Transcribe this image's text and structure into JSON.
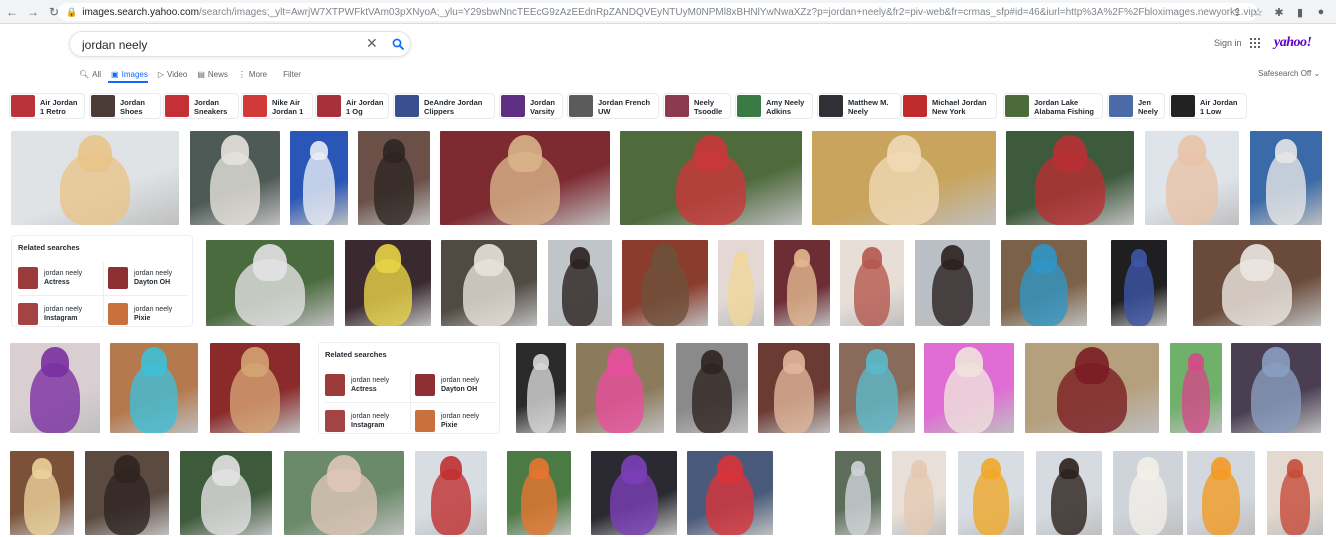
{
  "browser": {
    "url_host": "images.search.yahoo.com",
    "url_rest": "/search/images;_ylt=AwrjW7XTPWFktVAm03pXNyoA;_ylu=Y29sbwNncTEEcG9zAzEEdnRpZANDQVEyNTUyM0NPMl8xBHNlYwNwaXZz?p=jordan+neely&fr2=piv-web&fr=crmas_sfp#id=46&iurl=http%3A%2F%2Fbloximages.newyork1.vip.townnews.com%2Fstltoday.com%2Fcontent%2Ftncms%2Fassets%2..."
  },
  "search": {
    "query": "jordan neely",
    "clear_icon": "close-icon",
    "search_icon": "search-icon"
  },
  "header": {
    "sign_in": "Sign in",
    "logo": "yahoo!"
  },
  "tabs": [
    {
      "label": "All",
      "icon": "search-icon"
    },
    {
      "label": "Images",
      "icon": "image-icon",
      "active": true
    },
    {
      "label": "Video",
      "icon": "play-icon"
    },
    {
      "label": "News",
      "icon": "news-icon"
    },
    {
      "label": "More",
      "icon": "more-icon"
    },
    {
      "label": "Filter",
      "icon": ""
    }
  ],
  "safesearch": "Safesearch Off ⌄",
  "pills": [
    {
      "label": "Air Jordan\n1 Retro",
      "color": "#b8343a"
    },
    {
      "label": "Jordan\nShoes",
      "color": "#4a3b36"
    },
    {
      "label": "Jordan\nSneakers",
      "color": "#c43035"
    },
    {
      "label": "Nike Air\nJordan 1",
      "color": "#d23a3a"
    },
    {
      "label": "Air Jordan\n1 Og",
      "color": "#a7303a"
    },
    {
      "label": "DeAndre Jordan\nClippers",
      "color": "#3a4f8f"
    },
    {
      "label": "Jordan\nVarsity",
      "color": "#5e2f82"
    },
    {
      "label": "Jordan French\nUW",
      "color": "#5b5b5b"
    },
    {
      "label": "Neely\nTsoodle",
      "color": "#8c3a4f"
    },
    {
      "label": "Amy Neely\nAdkins",
      "color": "#3a7a44"
    },
    {
      "label": "Matthew M.\nNeely",
      "color": "#2f2f35"
    },
    {
      "label": "Michael Jordan\nNew York",
      "color": "#c02b2b"
    },
    {
      "label": "Jordan Lake\nAlabama Fishing",
      "color": "#4c6a3a"
    },
    {
      "label": "Jen\nNeely",
      "color": "#4a6aa8"
    },
    {
      "label": "Air Jordan\n1 Low",
      "color": "#222222"
    }
  ],
  "related_label": "Related searches",
  "related": [
    {
      "l1": "jordan neely",
      "l2": "Actress",
      "color": "#9c3b3b"
    },
    {
      "l1": "jordan neely",
      "l2": "Dayton OH",
      "color": "#8e2f34"
    },
    {
      "l1": "jordan neely",
      "l2": "Instagram",
      "color": "#a34343"
    },
    {
      "l1": "jordan neely",
      "l2": "Pixie",
      "color": "#c9703f"
    }
  ],
  "image_rows": [
    [
      {
        "bg": "#dfe3e6",
        "fig": "#e8c48a"
      },
      {
        "bg": "#4e5a55",
        "fig": "#e6e2dc"
      },
      {
        "bg": "#2a56b8",
        "fig": "#e9eef5"
      },
      {
        "bg": "#6b5048",
        "fig": "#2d2522"
      },
      {
        "bg": "#7d2a31",
        "fig": "#d9b48b"
      },
      {
        "bg": "#4f6b3d",
        "fig": "#c9373a"
      },
      {
        "bg": "#c9a45c",
        "fig": "#f0d9b5"
      },
      {
        "bg": "#3e5a3d",
        "fig": "#b83033"
      },
      {
        "bg": "#dfe4ea",
        "fig": "#e9c3a8"
      },
      {
        "bg": "#3b6aa8",
        "fig": "#e7e7e7"
      }
    ],
    [
      {
        "bg": "#4a6b3e",
        "fig": "#e2e2e2"
      },
      {
        "bg": "#3a2a2f",
        "fig": "#e8d447"
      },
      {
        "bg": "#4f4a42",
        "fig": "#e7e2da"
      },
      {
        "bg": "#bfc5c9",
        "fig": "#2a211f"
      },
      {
        "bg": "#8a3c2d",
        "fig": "#6e5039"
      },
      {
        "bg": "#e4d8d4",
        "fig": "#f0d79a"
      },
      {
        "bg": "#6d2d34",
        "fig": "#e2b891"
      },
      {
        "bg": "#e8ded8",
        "fig": "#b4584d"
      },
      {
        "bg": "#b9bfc4",
        "fig": "#2a211f"
      },
      {
        "bg": "#7b6147",
        "fig": "#2f96c6"
      },
      {
        "bg": "#1f1f22",
        "fig": "#3d55a6"
      },
      {
        "bg": "#6a4a3a",
        "fig": "#ece7e2"
      }
    ],
    [
      {
        "bg": "#d9cfd2",
        "fig": "#7a2fa0"
      },
      {
        "bg": "#b47a4e",
        "fig": "#3fbfd8"
      },
      {
        "bg": "#8a2a2a",
        "fig": "#d4a373"
      },
      {
        "bg": "#2a2a2a",
        "fig": "#d8d8d8"
      },
      {
        "bg": "#8c7a5c",
        "fig": "#e74f9c"
      },
      {
        "bg": "#8a8a8a",
        "fig": "#2e231f"
      },
      {
        "bg": "#6b3a32",
        "fig": "#e1b79a"
      },
      {
        "bg": "#8a6a5a",
        "fig": "#5ab9c9"
      },
      {
        "bg": "#e06dd4",
        "fig": "#efe2dc"
      },
      {
        "bg": "#b5a07e",
        "fig": "#7a1d22"
      },
      {
        "bg": "#6fb06a",
        "fig": "#d24b87"
      },
      {
        "bg": "#4a3f52",
        "fig": "#8a9ec0"
      }
    ],
    [
      {
        "bg": "#7b5238",
        "fig": "#ecd29a"
      },
      {
        "bg": "#5a4a40",
        "fig": "#2e2420"
      },
      {
        "bg": "#3d5a3b",
        "fig": "#e2e2e2"
      },
      {
        "bg": "#6b8a6a",
        "fig": "#dfc6b8"
      },
      {
        "bg": "#d7dde3",
        "fig": "#c02f2f"
      },
      {
        "bg": "#4c7a45",
        "fig": "#e7762e"
      },
      {
        "bg": "#2b2a33",
        "fig": "#7b3fb8"
      },
      {
        "bg": "#4a5a7a",
        "fig": "#d8333a"
      },
      {
        "bg": "#5c6e5a",
        "fig": "#cfd3d8"
      },
      {
        "bg": "#e8e0d8",
        "fig": "#e4c9b3"
      },
      {
        "bg": "#d8dde3",
        "fig": "#f0a92a"
      },
      {
        "bg": "#d6dbe2",
        "fig": "#2b201c"
      },
      {
        "bg": "#cfd4da",
        "fig": "#f2efe8"
      },
      {
        "bg": "#d3d8de",
        "fig": "#f39b23"
      },
      {
        "bg": "#e3d9ce",
        "fig": "#c74a3a"
      }
    ]
  ]
}
